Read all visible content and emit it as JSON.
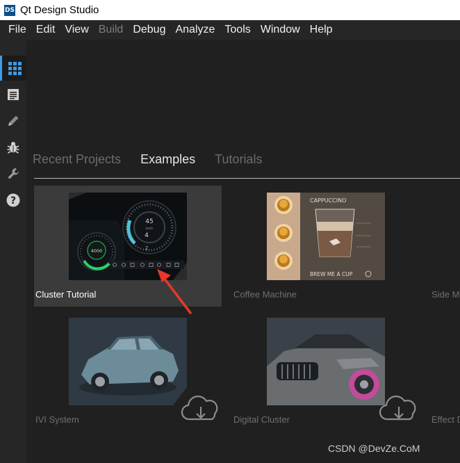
{
  "window": {
    "app_icon_text": "DS",
    "title": "Qt Design Studio"
  },
  "menu": [
    "File",
    "Edit",
    "View",
    "Build",
    "Debug",
    "Analyze",
    "Tools",
    "Window",
    "Help"
  ],
  "menu_disabled": [
    "Build"
  ],
  "modes": [
    {
      "name": "welcome",
      "icon": "grid-icon",
      "active": true
    },
    {
      "name": "edit",
      "icon": "document-icon",
      "active": false
    },
    {
      "name": "design",
      "icon": "pencil-icon",
      "active": false
    },
    {
      "name": "debug",
      "icon": "bug-icon",
      "active": false
    },
    {
      "name": "projects",
      "icon": "wrench-icon",
      "active": false
    },
    {
      "name": "help",
      "icon": "question-icon",
      "active": false
    }
  ],
  "tabs": [
    {
      "label": "Recent Projects",
      "active": false
    },
    {
      "label": "Examples",
      "active": true
    },
    {
      "label": "Tutorials",
      "active": false
    }
  ],
  "examples": [
    {
      "label": "Cluster Tutorial",
      "hovered": true
    },
    {
      "label": "Coffee Machine",
      "hovered": false
    },
    {
      "label": "Side Menu",
      "hovered": false
    },
    {
      "label": "IVI System",
      "hovered": false
    },
    {
      "label": "Digital Cluster",
      "hovered": false
    },
    {
      "label": "Effect Demo",
      "hovered": false
    }
  ],
  "cluster_thumb": {
    "speed": "45",
    "speed_unit": "km/h",
    "gear": "4",
    "gear_sub": "2",
    "rpm": "4000"
  },
  "coffee_thumb": {
    "title": "CAPPUCCINO",
    "cta": "BREW ME A CUP"
  },
  "watermark": "CSDN @DevZe.CoM",
  "colors": {
    "accent": "#3d9be9",
    "gauge_green": "#27d36a",
    "gauge_cyan": "#4fc1d9",
    "arrow": "#e8372b"
  }
}
